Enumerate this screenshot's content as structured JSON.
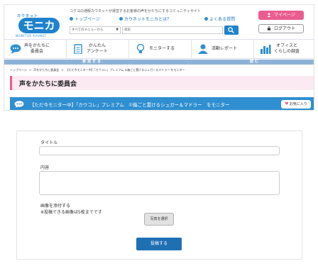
{
  "logo": {
    "top": "カウネット",
    "main": "モニカ",
    "en": "MONITOR KAUNET"
  },
  "header": {
    "tagline": "コクヨの通販カウネットが運営するお客様の声をかたちにするコミュニティサイト",
    "links": [
      "トップページ",
      "カウネットモニカとは？",
      "よくある質問"
    ],
    "search_select": "すべてのメニューから",
    "search_placeholder": "検索",
    "mypage_label": "マイページ",
    "logout_label": "ログアウト"
  },
  "nav": {
    "items": [
      {
        "label": "声をかたちに\n委員会",
        "icon": "chat-bubble-icon"
      },
      {
        "label": "かんたん\nアンケート",
        "icon": "clipboard-icon"
      },
      {
        "label": "モニターする",
        "icon": "lightbulb-icon"
      },
      {
        "label": "活動レポート",
        "icon": "person-icon"
      },
      {
        "label": "オフィスと\nくらしの調査",
        "icon": "bar-chart-icon"
      }
    ],
    "categories": [
      "参加する",
      "読む"
    ]
  },
  "breadcrumb": [
    "トップページ",
    "声をかたちに委員会",
    "【ただ今モニター中】「カウコレ」プレミアム ①箱ごと置けるシュガー＆マドラー をモニター"
  ],
  "page_title": "声をかたちに委員会",
  "banner": {
    "text": "【ただ今モニター中】「カウコレ」プレミアム　①箱ごと置けるシュガー＆マドラー　をモニター",
    "fav_label": "お気に入り"
  },
  "form": {
    "title_label": "タイトル",
    "title_value": "",
    "content_label": "内容",
    "content_value": "",
    "attach_label": "画像を添付する",
    "attach_note": "※投稿できる画像は5枚までです",
    "photo_button": "写真を選択",
    "submit_button": "投稿する"
  },
  "colors": {
    "brand_blue": "#1f82cc",
    "pink": "#ea5d8e",
    "banner_blue": "#2f8fd0",
    "submit_blue": "#1f6fb3",
    "category_bar": "#8fb3d6"
  }
}
